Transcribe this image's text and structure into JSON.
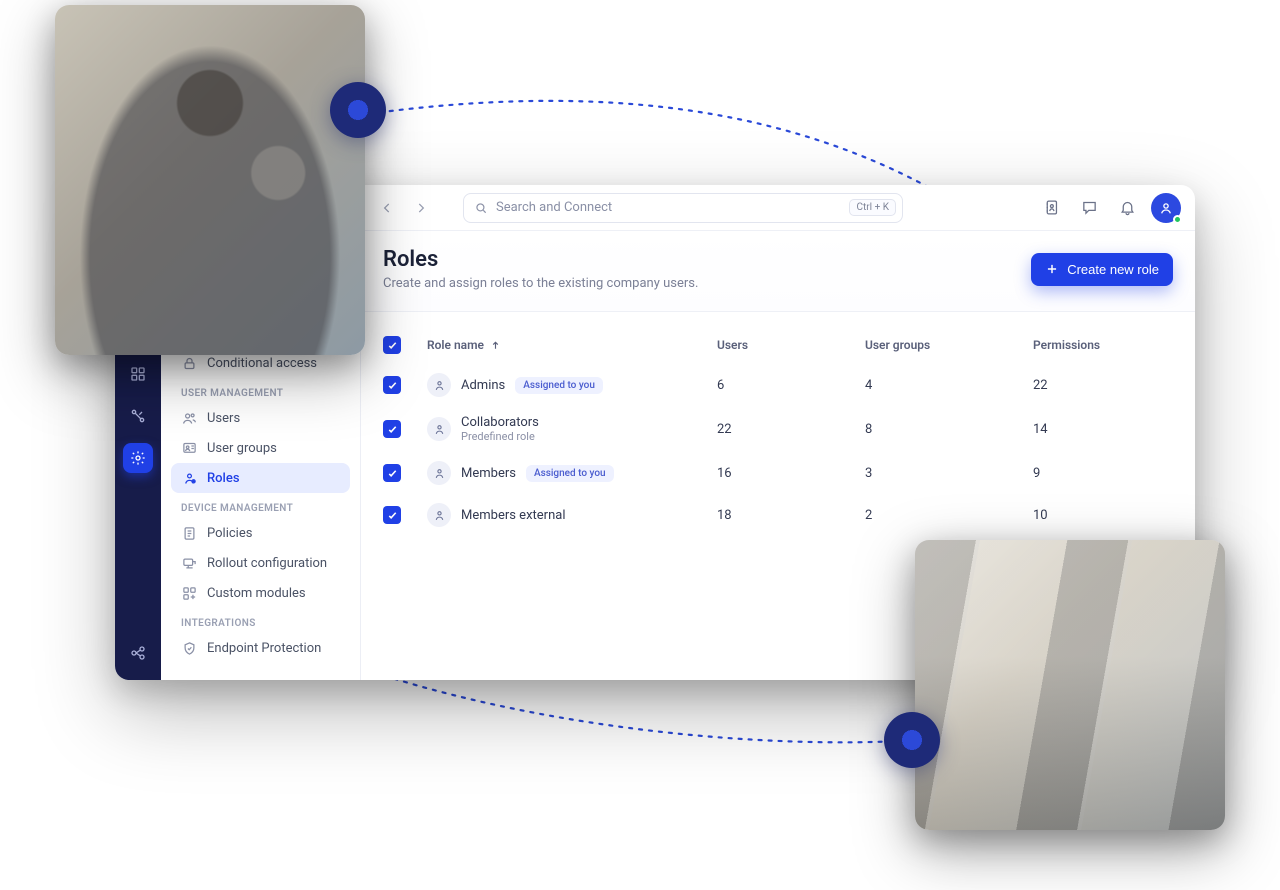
{
  "search": {
    "placeholder": "Search and Connect",
    "shortcut": "Ctrl + K"
  },
  "sidebar": {
    "conditional_access": "Conditional access",
    "sections": {
      "user_management": "USER MANAGEMENT",
      "device_management": "DEVICE MANAGEMENT",
      "integrations": "INTEGRATIONS"
    },
    "items": {
      "users": "Users",
      "user_groups": "User groups",
      "roles": "Roles",
      "policies": "Policies",
      "rollout": "Rollout configuration",
      "custom_modules": "Custom modules",
      "endpoint_protection": "Endpoint Protection"
    }
  },
  "page": {
    "title": "Roles",
    "subtitle": "Create and assign roles to the existing company users.",
    "create_button": "Create new role"
  },
  "table": {
    "headers": {
      "role_name": "Role name",
      "users": "Users",
      "user_groups": "User groups",
      "permissions": "Permissions"
    },
    "badge_assigned": "Assigned to you",
    "rows": [
      {
        "name": "Admins",
        "sub": "",
        "assigned": true,
        "users": "6",
        "groups": "4",
        "permissions": "22"
      },
      {
        "name": "Collaborators",
        "sub": "Predefined role",
        "assigned": false,
        "users": "22",
        "groups": "8",
        "permissions": "14"
      },
      {
        "name": "Members",
        "sub": "",
        "assigned": true,
        "users": "16",
        "groups": "3",
        "permissions": "9"
      },
      {
        "name": "Members external",
        "sub": "",
        "assigned": false,
        "users": "18",
        "groups": "2",
        "permissions": "10"
      }
    ]
  }
}
